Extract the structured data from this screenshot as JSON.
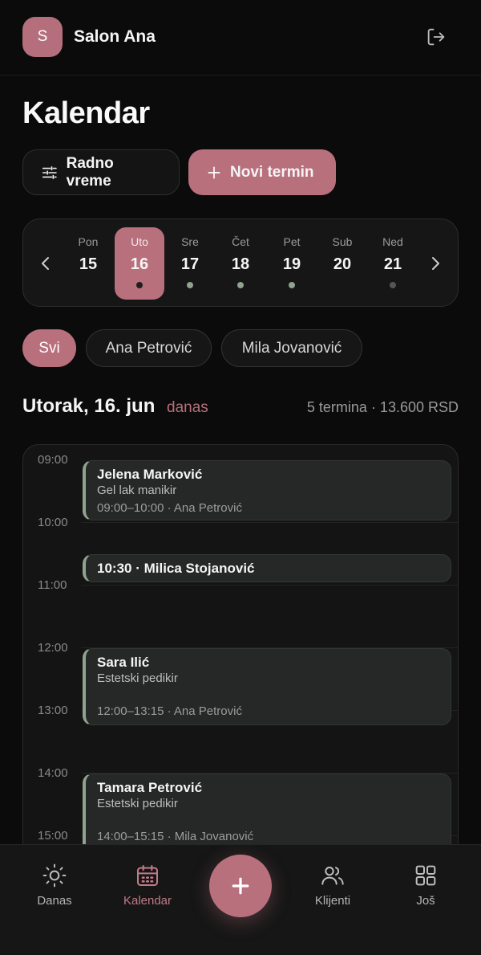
{
  "header": {
    "avatar_initial": "S",
    "salon_name": "Salon Ana",
    "logout_icon": "logout-icon"
  },
  "page": {
    "title": "Kalendar"
  },
  "actions": {
    "hours_label": "Radno vreme",
    "new_label": "Novi termin"
  },
  "week": {
    "days": [
      {
        "name": "Pon",
        "num": "15",
        "active": false,
        "dot": ""
      },
      {
        "name": "Uto",
        "num": "16",
        "active": true,
        "dot": "#1e1e1e"
      },
      {
        "name": "Sre",
        "num": "17",
        "active": false,
        "dot": "#8fa38e"
      },
      {
        "name": "Čet",
        "num": "18",
        "active": false,
        "dot": "#8fa38e"
      },
      {
        "name": "Pet",
        "num": "19",
        "active": false,
        "dot": "#8fa38e"
      },
      {
        "name": "Sub",
        "num": "20",
        "active": false,
        "dot": ""
      },
      {
        "name": "Ned",
        "num": "21",
        "active": false,
        "dot": "#555555"
      }
    ]
  },
  "filters": [
    "Svi",
    "Ana Petrović",
    "Mila Jovanović"
  ],
  "day": {
    "title": "Utorak, 16. jun",
    "today_tag": "danas",
    "summary": "5 termina · 13.600 RSD"
  },
  "timeline": {
    "hours": [
      "09:00",
      "10:00",
      "11:00",
      "12:00",
      "13:00",
      "14:00",
      "15:00"
    ],
    "appointments": [
      {
        "name": "Jelena Marković",
        "service": "Gel lak manikir",
        "meta": "09:00–10:00 · Ana Petrović"
      },
      {
        "name": "10:30 · Milica Stojanović"
      },
      {
        "name": "Sara Ilić",
        "service": "Estetski pedikir",
        "meta": "12:00–13:15 · Ana Petrović"
      },
      {
        "name": "Tamara Petrović",
        "service": "Estetski pedikir",
        "meta": "14:00–15:15 · Mila Jovanović"
      }
    ]
  },
  "nav": {
    "today": "Danas",
    "calendar": "Kalendar",
    "clients": "Klijenti",
    "more": "Još"
  },
  "colors": {
    "accent": "#b8707d",
    "appointment_bar": "#8fa38e",
    "background": "#0b0b0b"
  }
}
